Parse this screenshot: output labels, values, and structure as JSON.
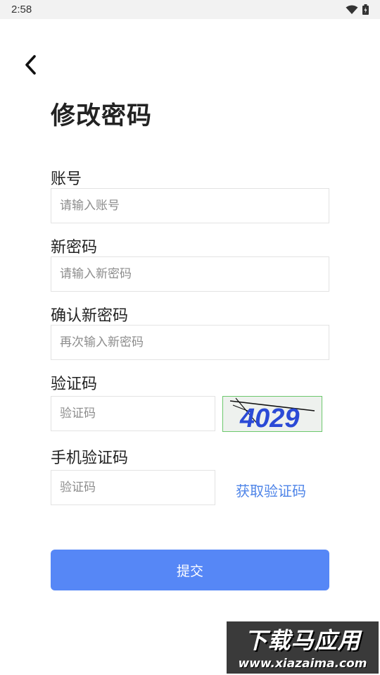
{
  "status_bar": {
    "time": "2:58",
    "icons": [
      "wifi-icon",
      "battery-icon"
    ]
  },
  "header": {
    "back_icon": "chevron-left-icon",
    "title": "修改密码"
  },
  "form": {
    "account": {
      "label": "账号",
      "placeholder": "请输入账号",
      "value": ""
    },
    "new_password": {
      "label": "新密码",
      "placeholder": "请输入新密码",
      "value": ""
    },
    "confirm_password": {
      "label": "确认新密码",
      "placeholder": "再次输入新密码",
      "value": ""
    },
    "captcha": {
      "label": "验证码",
      "placeholder": "验证码",
      "value": "",
      "image_text": "4029"
    },
    "sms_code": {
      "label": "手机验证码",
      "placeholder": "验证码",
      "value": "",
      "get_code_label": "获取验证码"
    },
    "submit_label": "提交"
  },
  "watermark": {
    "title": "下载马应用",
    "url": "www.xiazaima.com"
  },
  "colors": {
    "accent": "#5687f6",
    "link": "#4f85e8",
    "status_bar_bg": "#f2f2f2"
  }
}
